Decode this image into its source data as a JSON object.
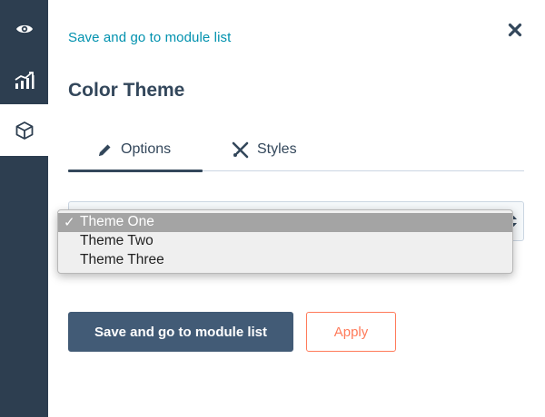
{
  "sidebar": {
    "items": [
      {
        "icon": "eye-icon",
        "active": false
      },
      {
        "icon": "analytics-chart-icon",
        "active": false
      },
      {
        "icon": "module-cube-icon",
        "active": true
      }
    ]
  },
  "panel": {
    "back_link": "Save and go to module list",
    "close_icon": "close-icon",
    "title": "Color Theme",
    "tabs": [
      {
        "label": "Options",
        "icon": "pencil-icon",
        "active": true
      },
      {
        "label": "Styles",
        "icon": "brush-ruler-icon",
        "active": false
      }
    ],
    "theme_select": {
      "selected": "Theme One",
      "options": [
        "Theme One",
        "Theme Two",
        "Theme Three"
      ],
      "check_mark": "✓"
    },
    "buttons": {
      "save_label": "Save and go to module list",
      "apply_label": "Apply"
    }
  },
  "colors": {
    "sidebar_bg": "#2d3e50",
    "link": "#0091ae",
    "text": "#33475b",
    "primary_button": "#425b76",
    "accent_orange": "#ff7a59"
  }
}
